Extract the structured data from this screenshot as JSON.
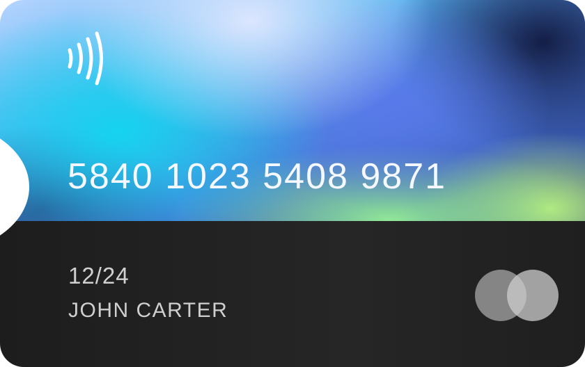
{
  "card": {
    "number": "5840 1023 5408 9871",
    "expiry": "12/24",
    "holder_name": "JOHN CARTER",
    "contactless_icon": "contactless-icon",
    "brand_logo_icon": "card-network-logo-icon"
  },
  "colors": {
    "top_accent_cyan": "#12d6f0",
    "top_accent_blue": "#4a78d8",
    "top_accent_green": "#96f096",
    "bottom_panel": "#222222",
    "number_text": "#f5f8ff",
    "detail_text": "#d0d0d0"
  }
}
